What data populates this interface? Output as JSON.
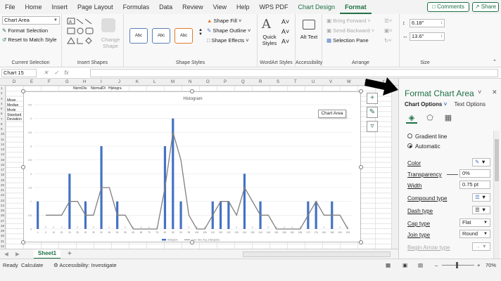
{
  "menu": {
    "tabs": [
      "File",
      "Home",
      "Insert",
      "Page Layout",
      "Formulas",
      "Data",
      "Review",
      "View",
      "Help",
      "WPS PDF",
      "Chart Design",
      "Format"
    ],
    "comments": "Comments",
    "share": "Share"
  },
  "ribbon": {
    "current_selection": {
      "dropdown": "Chart Area",
      "format_selection": "Format Selection",
      "reset": "Reset to Match Style",
      "label": "Current Selection"
    },
    "insert_shapes": {
      "change_shape": "Change Shape",
      "label": "Insert Shapes"
    },
    "shape_styles": {
      "swatches": [
        "Abc",
        "Abc",
        "Abc"
      ],
      "fill": "Shape Fill",
      "outline": "Shape Outline",
      "effects": "Shape Effects",
      "label": "Shape Styles"
    },
    "wordart": {
      "quick_styles": "Quick Styles",
      "label": "WordArt Styles"
    },
    "accessibility": {
      "alt_text": "Alt Text",
      "label": "Accessibility"
    },
    "arrange": {
      "bring_forward": "Bring Forward",
      "send_backward": "Send Backward",
      "selection_pane": "Selection Pane",
      "label": "Arrange"
    },
    "size": {
      "height": "6.18\"",
      "width": "13.6\"",
      "label": "Size"
    }
  },
  "formula_bar": {
    "name_box": "Chart 15",
    "fx": "fx",
    "formula": ""
  },
  "columns": [
    "D",
    "E",
    "F",
    "G",
    "H",
    "I",
    "J",
    "K",
    "L",
    "M",
    "N",
    "O",
    "P",
    "Q",
    "R",
    "S",
    "T",
    "U",
    "V",
    "W",
    "X",
    "Y"
  ],
  "row_numbers": [
    "1",
    "2",
    "3",
    "4",
    "5",
    "6",
    "7",
    "8",
    "9",
    "10",
    "11",
    "12",
    "13",
    "14",
    "15",
    "16",
    "17",
    "18",
    "19",
    "20",
    "21",
    "22",
    "23",
    "24",
    "25",
    "26",
    "27",
    "28",
    "29",
    "30",
    "31",
    "32"
  ],
  "cells": {
    "h1": "NormDis",
    "i1": "NormalDi",
    "j1": "Histogra",
    "d2": "Mean",
    "d3": "Median",
    "d4": "Mode",
    "d5": "Standard",
    "d6": "Deviation"
  },
  "chart_data": {
    "type": "bar",
    "title": "Histogram",
    "categories": [
      "0",
      "5",
      "10",
      "15",
      "20",
      "25",
      "30",
      "35",
      "40",
      "45",
      "50",
      "55",
      "60",
      "65",
      "70",
      "75",
      "80",
      "85",
      "90",
      "95",
      "100",
      "105",
      "110",
      "115",
      "120",
      "125",
      "130",
      "135",
      "140",
      "145",
      "150",
      "155",
      "160",
      "165",
      "170",
      "175",
      "180",
      "185",
      "190",
      "195"
    ],
    "series": [
      {
        "name": "Histogram",
        "type": "bar",
        "values": [
          1,
          0,
          0,
          0,
          2,
          0,
          1,
          0,
          3,
          0,
          1,
          0,
          0,
          0,
          0,
          0,
          3,
          4,
          1,
          0,
          0,
          0,
          1,
          1,
          1,
          0,
          2,
          0,
          1,
          0,
          0,
          0,
          0,
          0,
          1,
          1,
          0,
          1,
          0,
          0
        ]
      },
      {
        "name": "2 per. Mov. Avg. (Histogram)",
        "type": "line",
        "values": [
          null,
          0.5,
          0.5,
          0.5,
          1,
          1,
          0.5,
          0.5,
          1.5,
          1.5,
          0.5,
          0.5,
          0,
          0,
          0,
          0,
          1.5,
          3.5,
          2.5,
          0.5,
          0,
          0,
          0.5,
          1,
          1,
          0.5,
          1.5,
          1,
          0.5,
          0.5,
          0,
          0,
          0,
          0,
          0.5,
          1,
          0.5,
          0.5,
          0.5,
          0
        ]
      }
    ],
    "ylim": [
      0,
      4
    ],
    "yticks": [
      "0",
      "0.5",
      "1",
      "1.5",
      "2",
      "2.5",
      "3",
      "3.5",
      "4",
      "4.5"
    ],
    "grid": true,
    "legend": "bottom",
    "bar_color": "#4472c4",
    "line_color": "#7f7f7f"
  },
  "chart_tip": "Chart Area",
  "sheet": {
    "tab": "Sheet1",
    "add": "+"
  },
  "status": {
    "ready": "Ready",
    "calculate": "Calculate",
    "accessibility": "Accessibility: Investigate",
    "zoom": "70%"
  },
  "pane": {
    "title": "Format Chart Area",
    "tab_chart": "Chart Options",
    "tab_text": "Text Options",
    "gradient_line": "Gradient line",
    "automatic": "Automatic",
    "color": "Color",
    "transparency": "Transparency",
    "transparency_val": "0%",
    "width": "Width",
    "width_val": "0.75 pt",
    "compound": "Compound type",
    "dash": "Dash type",
    "cap": "Cap type",
    "cap_val": "Flat",
    "join": "Join type",
    "join_val": "Round",
    "begin_arrow": "Begin Arrow type"
  },
  "colors": {
    "accent": "#1e7145",
    "bar": "#4472c4"
  }
}
